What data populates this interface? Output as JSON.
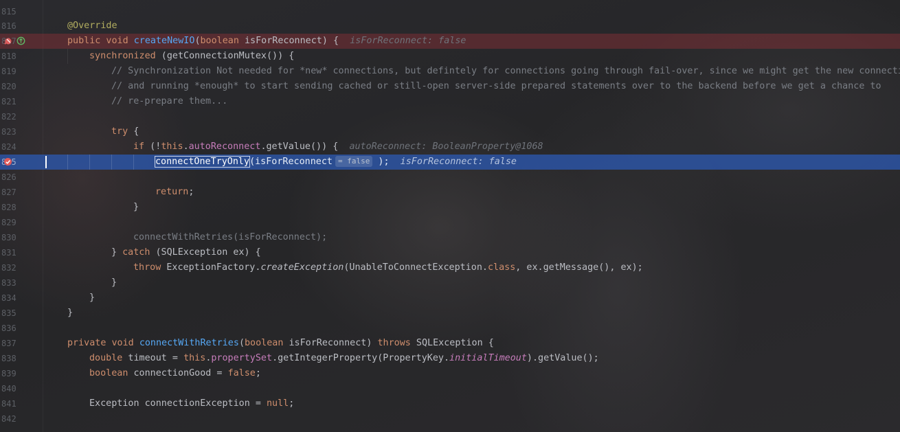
{
  "editor": {
    "lines": [
      {
        "num": "815",
        "text": ""
      },
      {
        "num": "816",
        "text": "@Override"
      },
      {
        "num": "817",
        "kw1": "public void ",
        "method": "createNewIO",
        "p1": "(",
        "kw2": "boolean",
        "p2": " isForReconnect) {",
        "hint": "isForReconnect: false"
      },
      {
        "num": "818",
        "kw": "synchronized",
        "rest": " (getConnectionMutex()) {"
      },
      {
        "num": "819",
        "comment": "// Synchronization Not needed for *new* connections, but defintely for connections going through fail-over, since we might get the new connectio"
      },
      {
        "num": "820",
        "comment": "// and running *enough* to start sending cached or still-open server-side prepared statements over to the backend before we get a chance to"
      },
      {
        "num": "821",
        "comment": "// re-prepare them..."
      },
      {
        "num": "822",
        "text": ""
      },
      {
        "num": "823",
        "kw": "try",
        "rest": " {"
      },
      {
        "num": "824",
        "kw1": "if",
        "p1": " (!",
        "kw2": "this",
        "p2": ".",
        "field": "autoReconnect",
        "p3": ".getValue()) {",
        "hint": "autoReconnect: BooleanProperty@1068"
      },
      {
        "num": "825",
        "method": "connectOneTryOnly",
        "args": "(isForReconnect",
        "inlay": "= false",
        "close": " );",
        "hint": "isForReconnect: false"
      },
      {
        "num": "826",
        "text": ""
      },
      {
        "num": "827",
        "kw": "return",
        "rest": ";"
      },
      {
        "num": "828",
        "text": "}"
      },
      {
        "num": "829",
        "text": ""
      },
      {
        "num": "830",
        "text": "connectWithRetries(isForReconnect);"
      },
      {
        "num": "831",
        "p1": "} ",
        "kw": "catch",
        "rest": " (SQLException ex) {"
      },
      {
        "num": "832",
        "kw": "throw",
        "p1": " ExceptionFactory.",
        "method": "createException",
        "p2": "(UnableToConnectException.",
        "kw2": "class",
        "p3": ", ex.getMessage(), ex);"
      },
      {
        "num": "833",
        "text": "}"
      },
      {
        "num": "834",
        "text": "}"
      },
      {
        "num": "835",
        "text": "}"
      },
      {
        "num": "836",
        "text": ""
      },
      {
        "num": "837",
        "kw1": "private void ",
        "method": "connectWithRetries",
        "p1": "(",
        "kw2": "boolean",
        "p2": " isForReconnect) ",
        "kw3": "throws",
        "p3": " SQLException {"
      },
      {
        "num": "838",
        "kw1": "double",
        "p1": " timeout = ",
        "kw2": "this",
        "p2": ".",
        "field": "propertySet",
        "p3": ".getIntegerProperty(PropertyKey.",
        "field2": "initialTimeout",
        "p4": ").getValue();"
      },
      {
        "num": "839",
        "kw1": "boolean",
        "p1": " connectionGood = ",
        "kw2": "false",
        "p2": ";"
      },
      {
        "num": "840",
        "text": ""
      },
      {
        "num": "841",
        "p1": "Exception connectionException = ",
        "kw": "null",
        "p2": ";"
      },
      {
        "num": "842",
        "text": ""
      }
    ]
  },
  "colors": {
    "keyword": "#cf8e6d",
    "annotation": "#b3ae60",
    "method": "#56a8f5",
    "field": "#c77dbb",
    "comment": "#7a7e85",
    "breakpoint_line": "#6b2f36",
    "execution_line": "#2c56a8"
  }
}
